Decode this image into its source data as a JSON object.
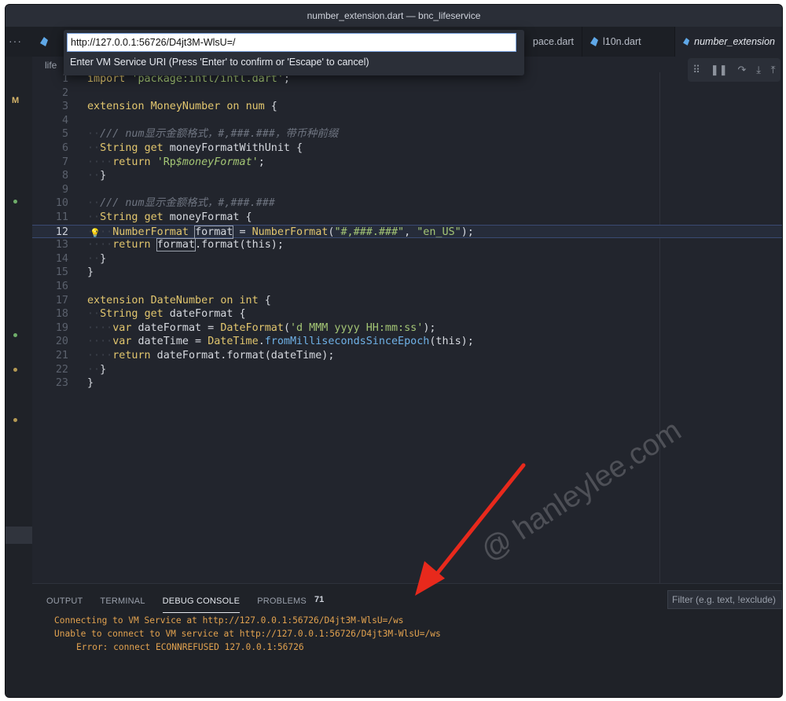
{
  "window": {
    "title": "number_extension.dart — bnc_lifeservice"
  },
  "tabs": [
    {
      "label": "pace.dart",
      "icon": "dart-icon"
    },
    {
      "label": "l10n.dart",
      "icon": "dart-icon"
    },
    {
      "label": "number_extension",
      "icon": "dart-icon"
    }
  ],
  "tab_more": "···",
  "breadcrumb": "life",
  "activity": {
    "scm_badge": "M"
  },
  "command_palette": {
    "value": "http://127.0.0.1:56726/D4jt3M-WlsU=/",
    "hint": "Enter VM Service URI (Press 'Enter' to confirm or 'Escape' to cancel)"
  },
  "debug_toolbar": [
    "drag-icon",
    "pause-icon",
    "step-over-icon",
    "step-into-icon",
    "step-out-icon"
  ],
  "editor": {
    "current_line": 12,
    "lines": [
      {
        "n": "1",
        "code": "import 'package:intl/intl.dart';"
      },
      {
        "n": "2",
        "code": ""
      },
      {
        "n": "3",
        "code": "extension MoneyNumber on num {"
      },
      {
        "n": "4",
        "code": ""
      },
      {
        "n": "5",
        "code": "  /// num显示金额格式，#,###.###，带币种前缀"
      },
      {
        "n": "6",
        "code": "  String get moneyFormatWithUnit {"
      },
      {
        "n": "7",
        "code": "    return 'Rp$moneyFormat';"
      },
      {
        "n": "8",
        "code": "  }"
      },
      {
        "n": "9",
        "code": ""
      },
      {
        "n": "10",
        "code": "  /// num显示金额格式，#,###.###"
      },
      {
        "n": "11",
        "code": "  String get moneyFormat {"
      },
      {
        "n": "12",
        "code": "    NumberFormat format = NumberFormat(\"#,###.###\", \"en_US\");"
      },
      {
        "n": "13",
        "code": "    return format.format(this);"
      },
      {
        "n": "14",
        "code": "  }"
      },
      {
        "n": "15",
        "code": "}"
      },
      {
        "n": "16",
        "code": ""
      },
      {
        "n": "17",
        "code": "extension DateNumber on int {"
      },
      {
        "n": "18",
        "code": "  String get dateFormat {"
      },
      {
        "n": "19",
        "code": "    var dateFormat = DateFormat('d MMM yyyy HH:mm:ss');"
      },
      {
        "n": "20",
        "code": "    var dateTime = DateTime.fromMillisecondsSinceEpoch(this);"
      },
      {
        "n": "21",
        "code": "    return dateFormat.format(dateTime);"
      },
      {
        "n": "22",
        "code": "  }"
      },
      {
        "n": "23",
        "code": "}"
      }
    ]
  },
  "panel": {
    "tabs": [
      {
        "label": "OUTPUT"
      },
      {
        "label": "TERMINAL"
      },
      {
        "label": "DEBUG CONSOLE"
      },
      {
        "label": "PROBLEMS"
      }
    ],
    "problems_count": "71",
    "filter_placeholder": "Filter (e.g. text, !exclude)",
    "console": [
      "Connecting to VM Service at http://127.0.0.1:56726/D4jt3M-WlsU=/ws",
      "Unable to connect to VM service at http://127.0.0.1:56726/D4jt3M-WlsU=/ws",
      "Error: connect ECONNREFUSED 127.0.0.1:56726"
    ]
  },
  "watermark": "@ hanleylee.com",
  "colors": {
    "accent": "#e2c66e",
    "annotation_arrow": "#e8291c",
    "console_text": "#e2a24f"
  }
}
